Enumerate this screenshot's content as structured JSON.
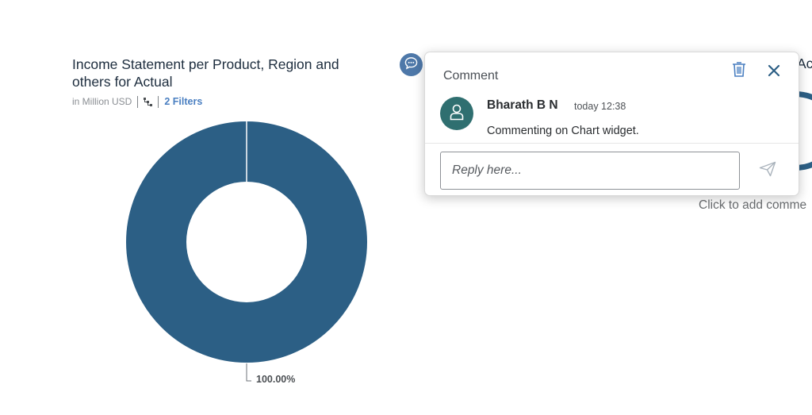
{
  "chart": {
    "title": "Income Statement per Product, Region and others for Actual",
    "unit": "in Million USD",
    "filters_label": "2 Filters",
    "data_label": "100.00%",
    "color": "#2c5f85"
  },
  "chart_data": {
    "type": "pie",
    "title": "Income Statement per Product, Region and others for Actual",
    "subtitle": "in Million USD",
    "values": [
      100.0
    ],
    "data_labels": [
      "100.00%"
    ],
    "colors": [
      "#2c5f85"
    ],
    "donut": true
  },
  "background": {
    "right_title_fragment": "Ac",
    "hint_text": "Click to add comme"
  },
  "comment_popover": {
    "title": "Comment",
    "author": "Bharath B N",
    "timestamp": "today 12:38",
    "text": "Commenting on Chart widget.",
    "reply_placeholder": "Reply here...",
    "icons": {
      "delete": "trash-icon",
      "close": "close-icon",
      "send": "send-icon",
      "avatar": "person-icon",
      "indicator": "comment-bubble-icon"
    }
  }
}
